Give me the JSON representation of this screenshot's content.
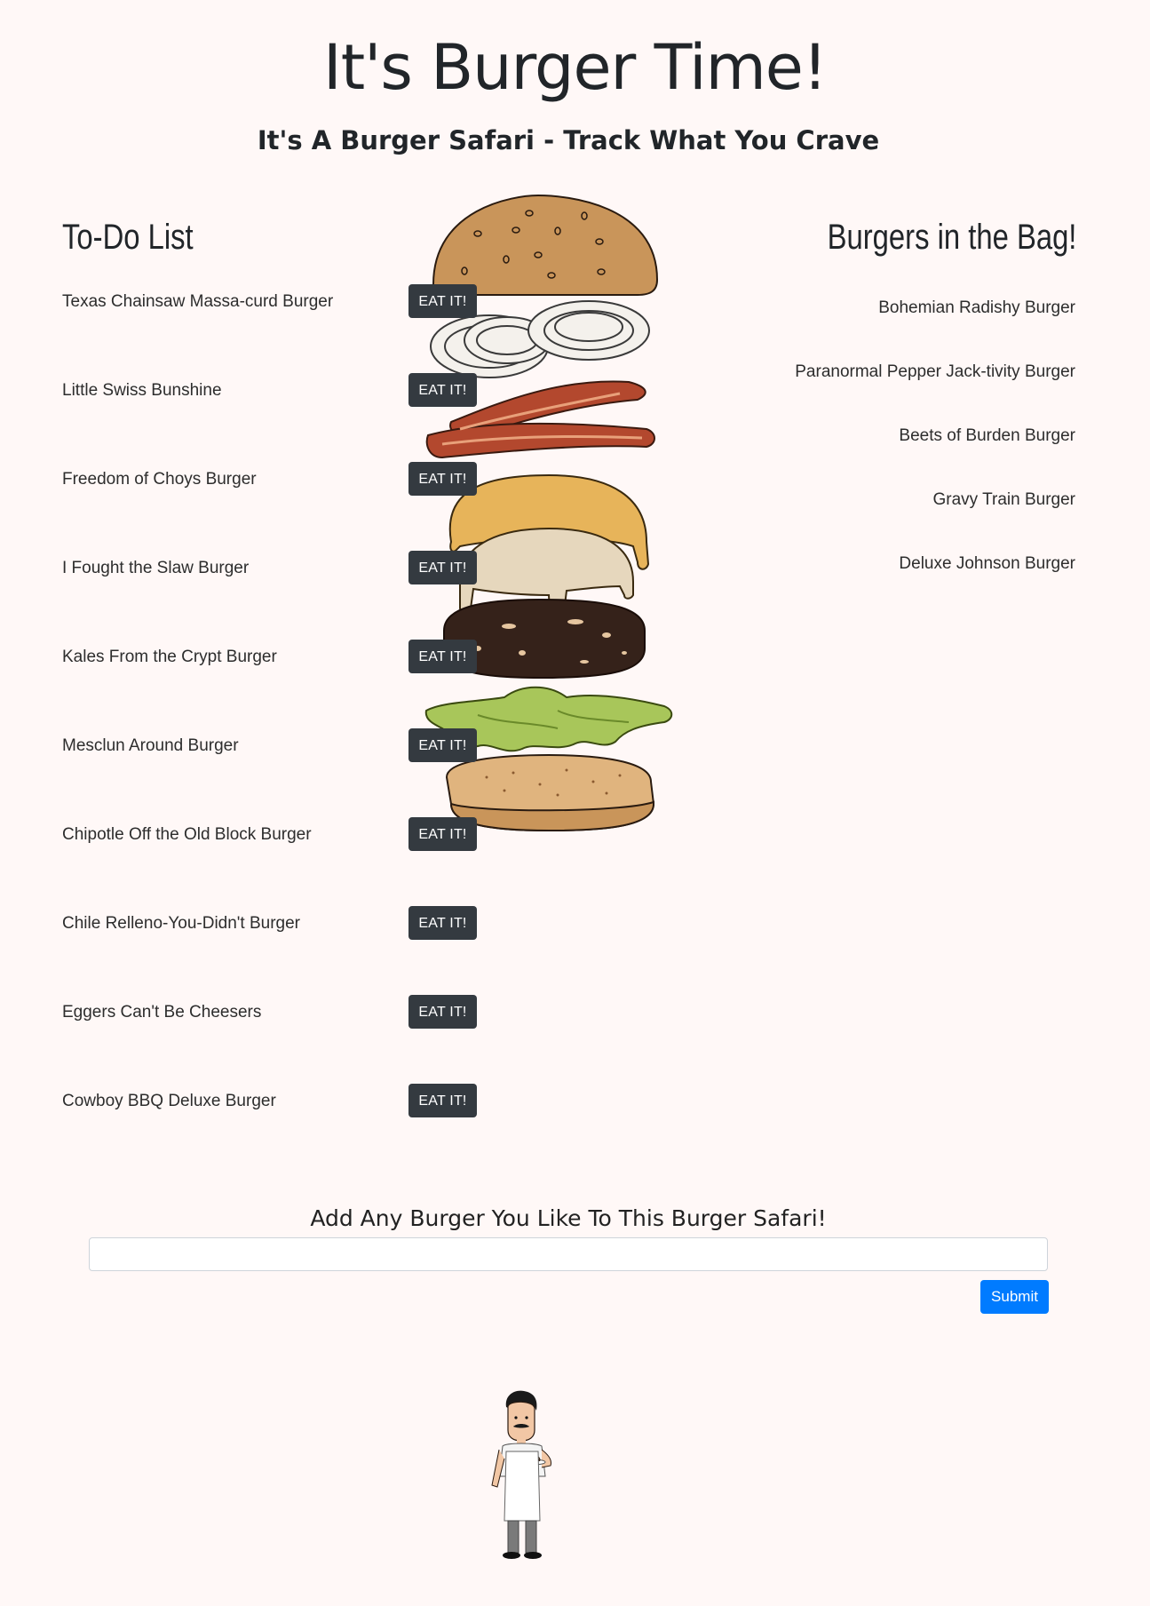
{
  "header": {
    "title": "It's Burger Time!",
    "subtitle": "It's A Burger Safari - Track What You Crave"
  },
  "todo": {
    "heading": "To-Do List",
    "button_label": "EAT IT!",
    "items": [
      "Texas Chainsaw Massa-curd Burger",
      "Little Swiss Bunshine",
      "Freedom of Choys Burger",
      "I Fought the Slaw Burger",
      "Kales From the Crypt Burger",
      "Mesclun Around Burger",
      "Chipotle Off the Old Block Burger",
      "Chile Relleno-You-Didn't Burger",
      "Eggers Can't Be Cheesers",
      "Cowboy BBQ Deluxe Burger"
    ]
  },
  "bag": {
    "heading": "Burgers in the Bag!",
    "items": [
      "Bohemian Radishy Burger",
      "Paranormal Pepper Jack-tivity Burger",
      "Beets of Burden Burger",
      "Gravy Train Burger",
      "Deluxe Johnson Burger"
    ]
  },
  "form": {
    "heading": "Add Any Burger You Like To This Burger Safari!",
    "input_value": "",
    "submit_label": "Submit"
  },
  "colors": {
    "background": "#fff8f7",
    "eat_button": "#343a40",
    "submit_button": "#007bff"
  },
  "icons": {
    "burger_illustration": "exploded-burger-icon",
    "chef_illustration": "chef-holding-burger-icon"
  }
}
